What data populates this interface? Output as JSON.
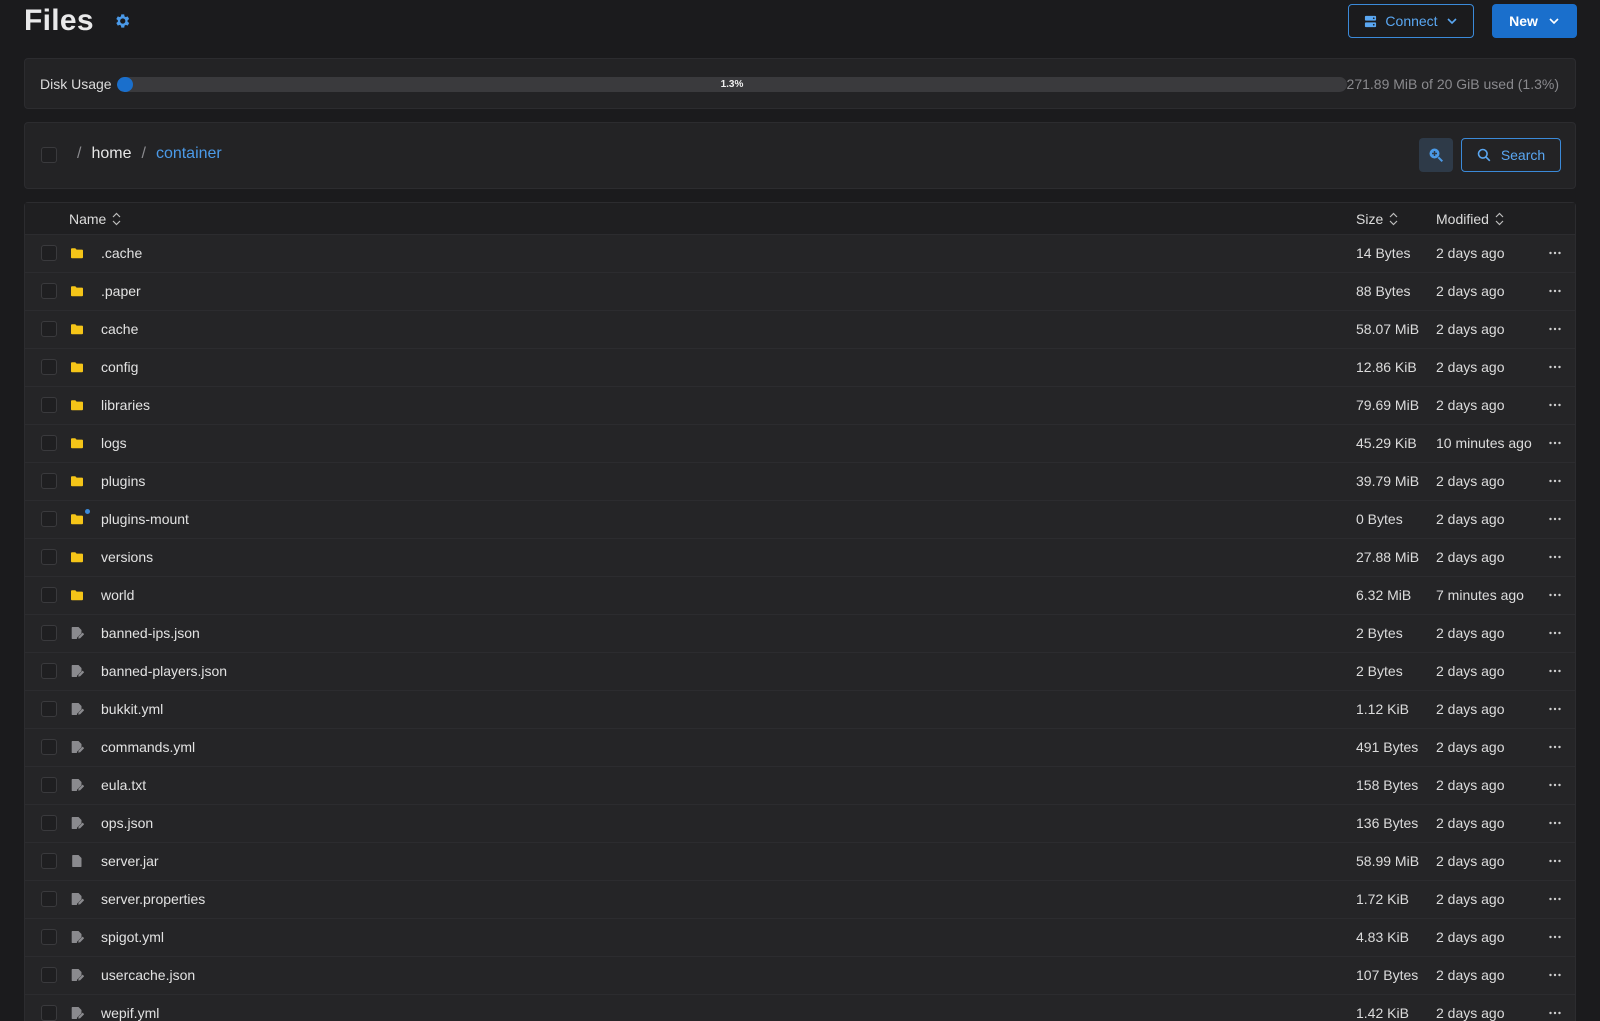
{
  "header": {
    "title": "Files",
    "connect_label": "Connect",
    "new_label": "New"
  },
  "disk": {
    "label": "Disk Usage",
    "percent_label": "1.3%",
    "used_fraction": 0.013,
    "summary": "271.89 MiB of 20 GiB used (1.3%)"
  },
  "breadcrumb": {
    "separator": "/",
    "home": "home",
    "current": "container"
  },
  "search": {
    "label": "Search"
  },
  "table": {
    "columns": {
      "name": "Name",
      "size": "Size",
      "modified": "Modified"
    },
    "rows": [
      {
        "name": ".cache",
        "size": "14 Bytes",
        "modified": "2 days ago",
        "type": "folder"
      },
      {
        "name": ".paper",
        "size": "88 Bytes",
        "modified": "2 days ago",
        "type": "folder"
      },
      {
        "name": "cache",
        "size": "58.07 MiB",
        "modified": "2 days ago",
        "type": "folder"
      },
      {
        "name": "config",
        "size": "12.86 KiB",
        "modified": "2 days ago",
        "type": "folder"
      },
      {
        "name": "libraries",
        "size": "79.69 MiB",
        "modified": "2 days ago",
        "type": "folder"
      },
      {
        "name": "logs",
        "size": "45.29 KiB",
        "modified": "10 minutes ago",
        "type": "folder"
      },
      {
        "name": "plugins",
        "size": "39.79 MiB",
        "modified": "2 days ago",
        "type": "folder"
      },
      {
        "name": "plugins-mount",
        "size": "0 Bytes",
        "modified": "2 days ago",
        "type": "folder-mount"
      },
      {
        "name": "versions",
        "size": "27.88 MiB",
        "modified": "2 days ago",
        "type": "folder"
      },
      {
        "name": "world",
        "size": "6.32 MiB",
        "modified": "7 minutes ago",
        "type": "folder"
      },
      {
        "name": "banned-ips.json",
        "size": "2 Bytes",
        "modified": "2 days ago",
        "type": "text-file"
      },
      {
        "name": "banned-players.json",
        "size": "2 Bytes",
        "modified": "2 days ago",
        "type": "text-file"
      },
      {
        "name": "bukkit.yml",
        "size": "1.12 KiB",
        "modified": "2 days ago",
        "type": "text-file"
      },
      {
        "name": "commands.yml",
        "size": "491 Bytes",
        "modified": "2 days ago",
        "type": "text-file"
      },
      {
        "name": "eula.txt",
        "size": "158 Bytes",
        "modified": "2 days ago",
        "type": "text-file"
      },
      {
        "name": "ops.json",
        "size": "136 Bytes",
        "modified": "2 days ago",
        "type": "text-file"
      },
      {
        "name": "server.jar",
        "size": "58.99 MiB",
        "modified": "2 days ago",
        "type": "binary-file"
      },
      {
        "name": "server.properties",
        "size": "1.72 KiB",
        "modified": "2 days ago",
        "type": "text-file"
      },
      {
        "name": "spigot.yml",
        "size": "4.83 KiB",
        "modified": "2 days ago",
        "type": "text-file"
      },
      {
        "name": "usercache.json",
        "size": "107 Bytes",
        "modified": "2 days ago",
        "type": "text-file"
      },
      {
        "name": "wepif.yml",
        "size": "1.42 KiB",
        "modified": "2 days ago",
        "type": "text-file"
      }
    ]
  },
  "colors": {
    "accent": "#1a6fcc",
    "accent_text": "#4b9ae8",
    "folder": "#f5c518",
    "file_icon": "#8a8a8e",
    "background": "#1b1b1d"
  }
}
